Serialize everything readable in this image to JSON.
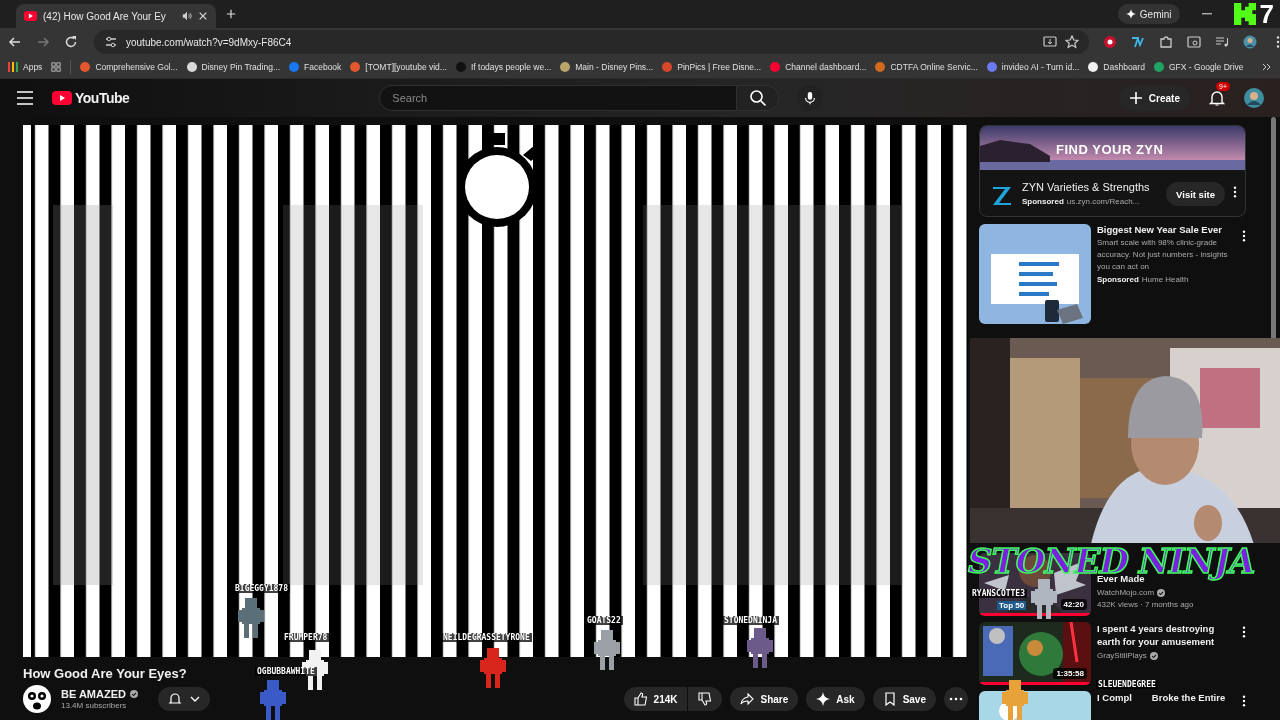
{
  "browser": {
    "tabs": [
      {
        "title": "(42) How Good Are Your Ey",
        "selected": true
      }
    ],
    "address": "youtube.com/watch?v=9dMxy-F86C4",
    "gemini": "Gemini",
    "apps": "Apps",
    "bookmarks": [
      {
        "label": "Comprehensive Gol...",
        "color": "#e2582c"
      },
      {
        "label": "Disney Pin Trading...",
        "color": "#d9d9d9"
      },
      {
        "label": "Facebook",
        "color": "#1877f2"
      },
      {
        "label": "[TOMT][youtube vid...",
        "color": "#e2582c"
      },
      {
        "label": "If todays people we...",
        "color": "#111111"
      },
      {
        "label": "Main - Disney Pins...",
        "color": "#b9a46a"
      },
      {
        "label": "PinPics | Free Disne...",
        "color": "#d9472b"
      },
      {
        "label": "Channel dashboard...",
        "color": "#ff0033"
      },
      {
        "label": "CDTFA Online Servic...",
        "color": "#d2691e"
      },
      {
        "label": "invideo AI - Turn id...",
        "color": "#6a7cf0"
      },
      {
        "label": "Dashboard",
        "color": "#f1f1f1"
      },
      {
        "label": "GFX - Google Drive",
        "color": "#1fa463"
      }
    ]
  },
  "youtube": {
    "logo": "YouTube",
    "search": {
      "placeholder": "Search"
    },
    "create": "Create",
    "notifications": "9+",
    "video": {
      "title": "How Good Are Your Eyes?",
      "channel": "BE AMAZED",
      "subscribers": "13.4M subscribers",
      "likes": "214K",
      "actions": [
        {
          "kind": "share",
          "label": "Share"
        },
        {
          "kind": "ask",
          "label": "Ask"
        },
        {
          "kind": "save",
          "label": "Save"
        }
      ]
    },
    "ads": [
      {
        "kind": "banner",
        "banner_text": "FIND YOUR ZYN",
        "title": "ZYN Varieties & Strengths",
        "sponsored": "Sponsored",
        "source": "us.zyn.com/Reach...",
        "button": "Visit site"
      },
      {
        "kind": "product",
        "title": "Biggest New Year Sale Ever",
        "description": "Smart scale with 98% clinic-grade accuracy. Not just numbers - insights you can act on",
        "sponsored": "Sponsored",
        "source": "Hume Health"
      }
    ],
    "recommendations": [
      {
        "title": "Ever Made",
        "channel": "WatchMojo.com",
        "meta": "432K views · 7 months ago",
        "duration": "42:20",
        "badge": "Top 50"
      },
      {
        "title": "I spent 4 years destroying earth for your amusement",
        "channel": "GrayStillPlays",
        "duration": "1:35:58"
      },
      {
        "title": "I Compl",
        "title_rest": "Broke the Entire"
      }
    ]
  },
  "overlay": {
    "stream_label": "STONED NINJA",
    "corner_badge": "7",
    "viewers": [
      {
        "name": "BIGEGGY1878",
        "color": "#5b6f78"
      },
      {
        "name": "FRUMPER78",
        "color": "#f2f2f2"
      },
      {
        "name": "OGBUBBAWHITE",
        "color": "#3a5bc7"
      },
      {
        "name": "NEILDEGRASSETYRONE",
        "color": "#d8261c"
      },
      {
        "name": "GOATS22",
        "color": "#9aa0a6"
      },
      {
        "name": "STONEDNINJA",
        "color": "#6b5a8a"
      },
      {
        "name": "RYANSCOTTE3",
        "color": "#b0b6c0"
      },
      {
        "name": "SLEUENDEGREE",
        "color": "#e8a23a"
      }
    ]
  }
}
